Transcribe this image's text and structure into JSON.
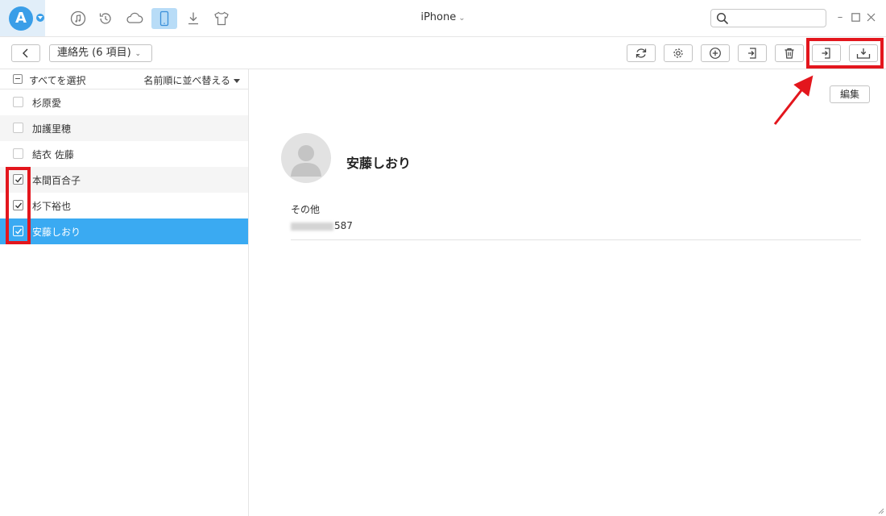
{
  "titlebar": {
    "device_name": "iPhone",
    "nav_icons": [
      "music-icon",
      "history-icon",
      "cloud-icon",
      "phone-icon",
      "download-icon",
      "tshirt-icon"
    ],
    "search": {
      "value": "",
      "placeholder": ""
    },
    "window_controls": [
      "minimize-icon",
      "maximize-icon",
      "close-icon"
    ]
  },
  "toolbar": {
    "breadcrumb": "連絡先 (6 項目)",
    "actions": [
      "refresh-icon",
      "settings-icon",
      "add-icon",
      "import-icon",
      "delete-icon",
      "to-device-icon",
      "to-computer-icon"
    ]
  },
  "list": {
    "select_all_label": "すべてを選択",
    "sort_label": "名前順に並べ替える",
    "contacts": [
      {
        "name": "杉原愛",
        "checked": false,
        "selected": false
      },
      {
        "name": "加護里穂",
        "checked": false,
        "selected": false
      },
      {
        "name": "結衣 佐藤",
        "checked": false,
        "selected": false
      },
      {
        "name": "本間百合子",
        "checked": true,
        "selected": false
      },
      {
        "name": "杉下裕也",
        "checked": true,
        "selected": false
      },
      {
        "name": "安藤しおり",
        "checked": true,
        "selected": true
      }
    ]
  },
  "detail": {
    "edit_label": "編集",
    "name": "安藤しおり",
    "field_label": "その他",
    "phone_visible_suffix": "587"
  },
  "colors": {
    "accent": "#3aaaf2",
    "highlight": "#e3161d",
    "logo": "#3a9ee8"
  }
}
